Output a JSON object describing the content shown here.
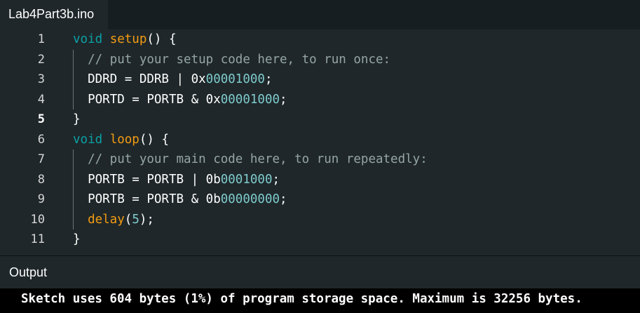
{
  "tab": {
    "filename": "Lab4Part3b.ino"
  },
  "editor": {
    "active_line": 5,
    "lines": [
      {
        "num": "1",
        "tokens": [
          {
            "t": "void",
            "c": "kw"
          },
          {
            "t": " "
          },
          {
            "t": "setup",
            "c": "fn"
          },
          {
            "t": "() {"
          }
        ]
      },
      {
        "num": "2",
        "tokens": [
          {
            "t": "  "
          },
          {
            "t": "// put your setup code here, to run once:",
            "c": "cm"
          }
        ]
      },
      {
        "num": "3",
        "tokens": [
          {
            "t": "  DDRD = DDRB | "
          },
          {
            "t": "0x"
          },
          {
            "t": "00001000",
            "c": "num"
          },
          {
            "t": ";"
          }
        ]
      },
      {
        "num": "4",
        "tokens": [
          {
            "t": "  PORTD = PORTB & "
          },
          {
            "t": "0x"
          },
          {
            "t": "00001000",
            "c": "num"
          },
          {
            "t": ";"
          }
        ]
      },
      {
        "num": "5",
        "tokens": [
          {
            "t": "}"
          }
        ]
      },
      {
        "num": "6",
        "tokens": [
          {
            "t": "void",
            "c": "kw"
          },
          {
            "t": " "
          },
          {
            "t": "loop",
            "c": "fn"
          },
          {
            "t": "() {"
          }
        ]
      },
      {
        "num": "7",
        "tokens": [
          {
            "t": "  "
          },
          {
            "t": "// put your main code here, to run repeatedly:",
            "c": "cm"
          }
        ]
      },
      {
        "num": "8",
        "tokens": [
          {
            "t": "  PORTB = PORTB | "
          },
          {
            "t": "0b"
          },
          {
            "t": "0001000",
            "c": "num"
          },
          {
            "t": ";"
          }
        ]
      },
      {
        "num": "9",
        "tokens": [
          {
            "t": "  PORTB = PORTB & "
          },
          {
            "t": "0b"
          },
          {
            "t": "00000000",
            "c": "num"
          },
          {
            "t": ";"
          }
        ]
      },
      {
        "num": "10",
        "tokens": [
          {
            "t": "  "
          },
          {
            "t": "delay",
            "c": "fn"
          },
          {
            "t": "("
          },
          {
            "t": "5",
            "c": "num"
          },
          {
            "t": ");"
          }
        ]
      },
      {
        "num": "11",
        "tokens": [
          {
            "t": "}"
          }
        ]
      }
    ]
  },
  "output": {
    "title": "Output",
    "message": "Sketch uses 604 bytes (1%) of program storage space. Maximum is 32256 bytes."
  },
  "colors": {
    "background": "#1f272a",
    "keyword": "#0ca1a6",
    "function": "#f39c12",
    "comment": "#95a5a6",
    "number": "#7fcbcd"
  }
}
